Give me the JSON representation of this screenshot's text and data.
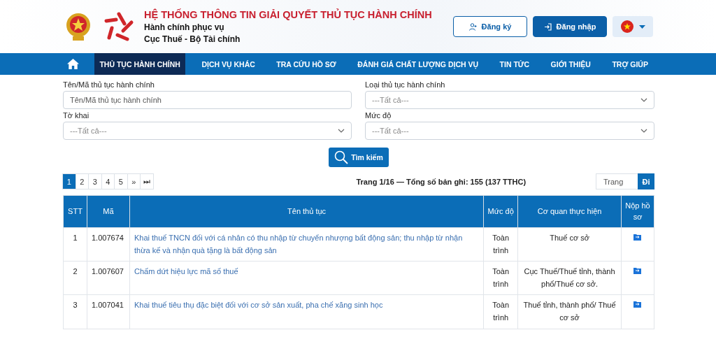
{
  "header": {
    "title": "HỆ THỐNG THÔNG TIN GIẢI QUYẾT THỦ TỤC HÀNH CHÍNH",
    "subtitle": "Hành chính phục vụ",
    "agency": "Cục Thuế - Bộ Tài chính",
    "register": "Đăng ký",
    "login": "Đăng nhập"
  },
  "nav": [
    {
      "label": "THỦ TỤC HÀNH CHÍNH",
      "selected": true
    },
    {
      "label": "DỊCH VỤ KHÁC",
      "selected": false
    },
    {
      "label": "TRA CỨU HỒ SƠ",
      "selected": false
    },
    {
      "label": "ĐÁNH GIÁ CHẤT LƯỢNG DỊCH VỤ",
      "selected": false
    },
    {
      "label": "TIN TỨC",
      "selected": false
    },
    {
      "label": "GIỚI THIỆU",
      "selected": false
    },
    {
      "label": "TRỢ GIÚP",
      "selected": false
    }
  ],
  "filters": [
    {
      "kind": "text",
      "label": "Tên/Mã thủ tục hành chính",
      "placeholder": "Tên/Mã thủ tục hành chính"
    },
    {
      "kind": "select",
      "label": "Loại thủ tục hành chính",
      "value": "---Tất cả---"
    },
    {
      "kind": "select",
      "label": "Tờ khai",
      "value": "---Tất cả---"
    },
    {
      "kind": "select",
      "label": "Mức độ",
      "value": "---Tất cả---"
    }
  ],
  "search_button": "Tìm kiếm",
  "pagination": {
    "pages": [
      {
        "label": "1",
        "selected": true
      },
      {
        "label": "2",
        "selected": false
      },
      {
        "label": "3",
        "selected": false
      },
      {
        "label": "4",
        "selected": false
      },
      {
        "label": "5",
        "selected": false
      },
      {
        "label": "»",
        "selected": false
      },
      {
        "label": "⏭",
        "selected": false
      }
    ],
    "summary": "Trang 1/16 — Tổng số bản ghi: 155 (137 TTHC)",
    "page_placeholder": "Trang",
    "go": "Đi"
  },
  "table": {
    "columns": [
      "STT",
      "Mã",
      "Tên thủ tục",
      "Mức độ",
      "Cơ quan thực hiện",
      "Nộp hồ sơ"
    ],
    "rows": [
      {
        "stt": "1",
        "code": "1.007674",
        "name": "Khai thuế TNCN đối với cá nhân có thu nhập từ chuyển nhượng bất động sản; thu nhập từ nhận thừa kế và nhận quà tặng là bất động sản",
        "level": "Toàn trình",
        "agency": "Thuế cơ sở"
      },
      {
        "stt": "2",
        "code": "1.007607",
        "name": "Chấm dứt hiệu lực mã số thuế",
        "level": "Toàn trình",
        "agency": "Cục Thuế/Thuế tỉnh, thành phố/Thuế cơ sở."
      },
      {
        "stt": "3",
        "code": "1.007041",
        "name": "Khai thuế tiêu thụ đặc biệt đối với cơ sở sản xuất, pha chế xăng sinh học",
        "level": "Toàn trình",
        "agency": "Thuế tỉnh, thành phố/ Thuế cơ sở"
      }
    ]
  }
}
